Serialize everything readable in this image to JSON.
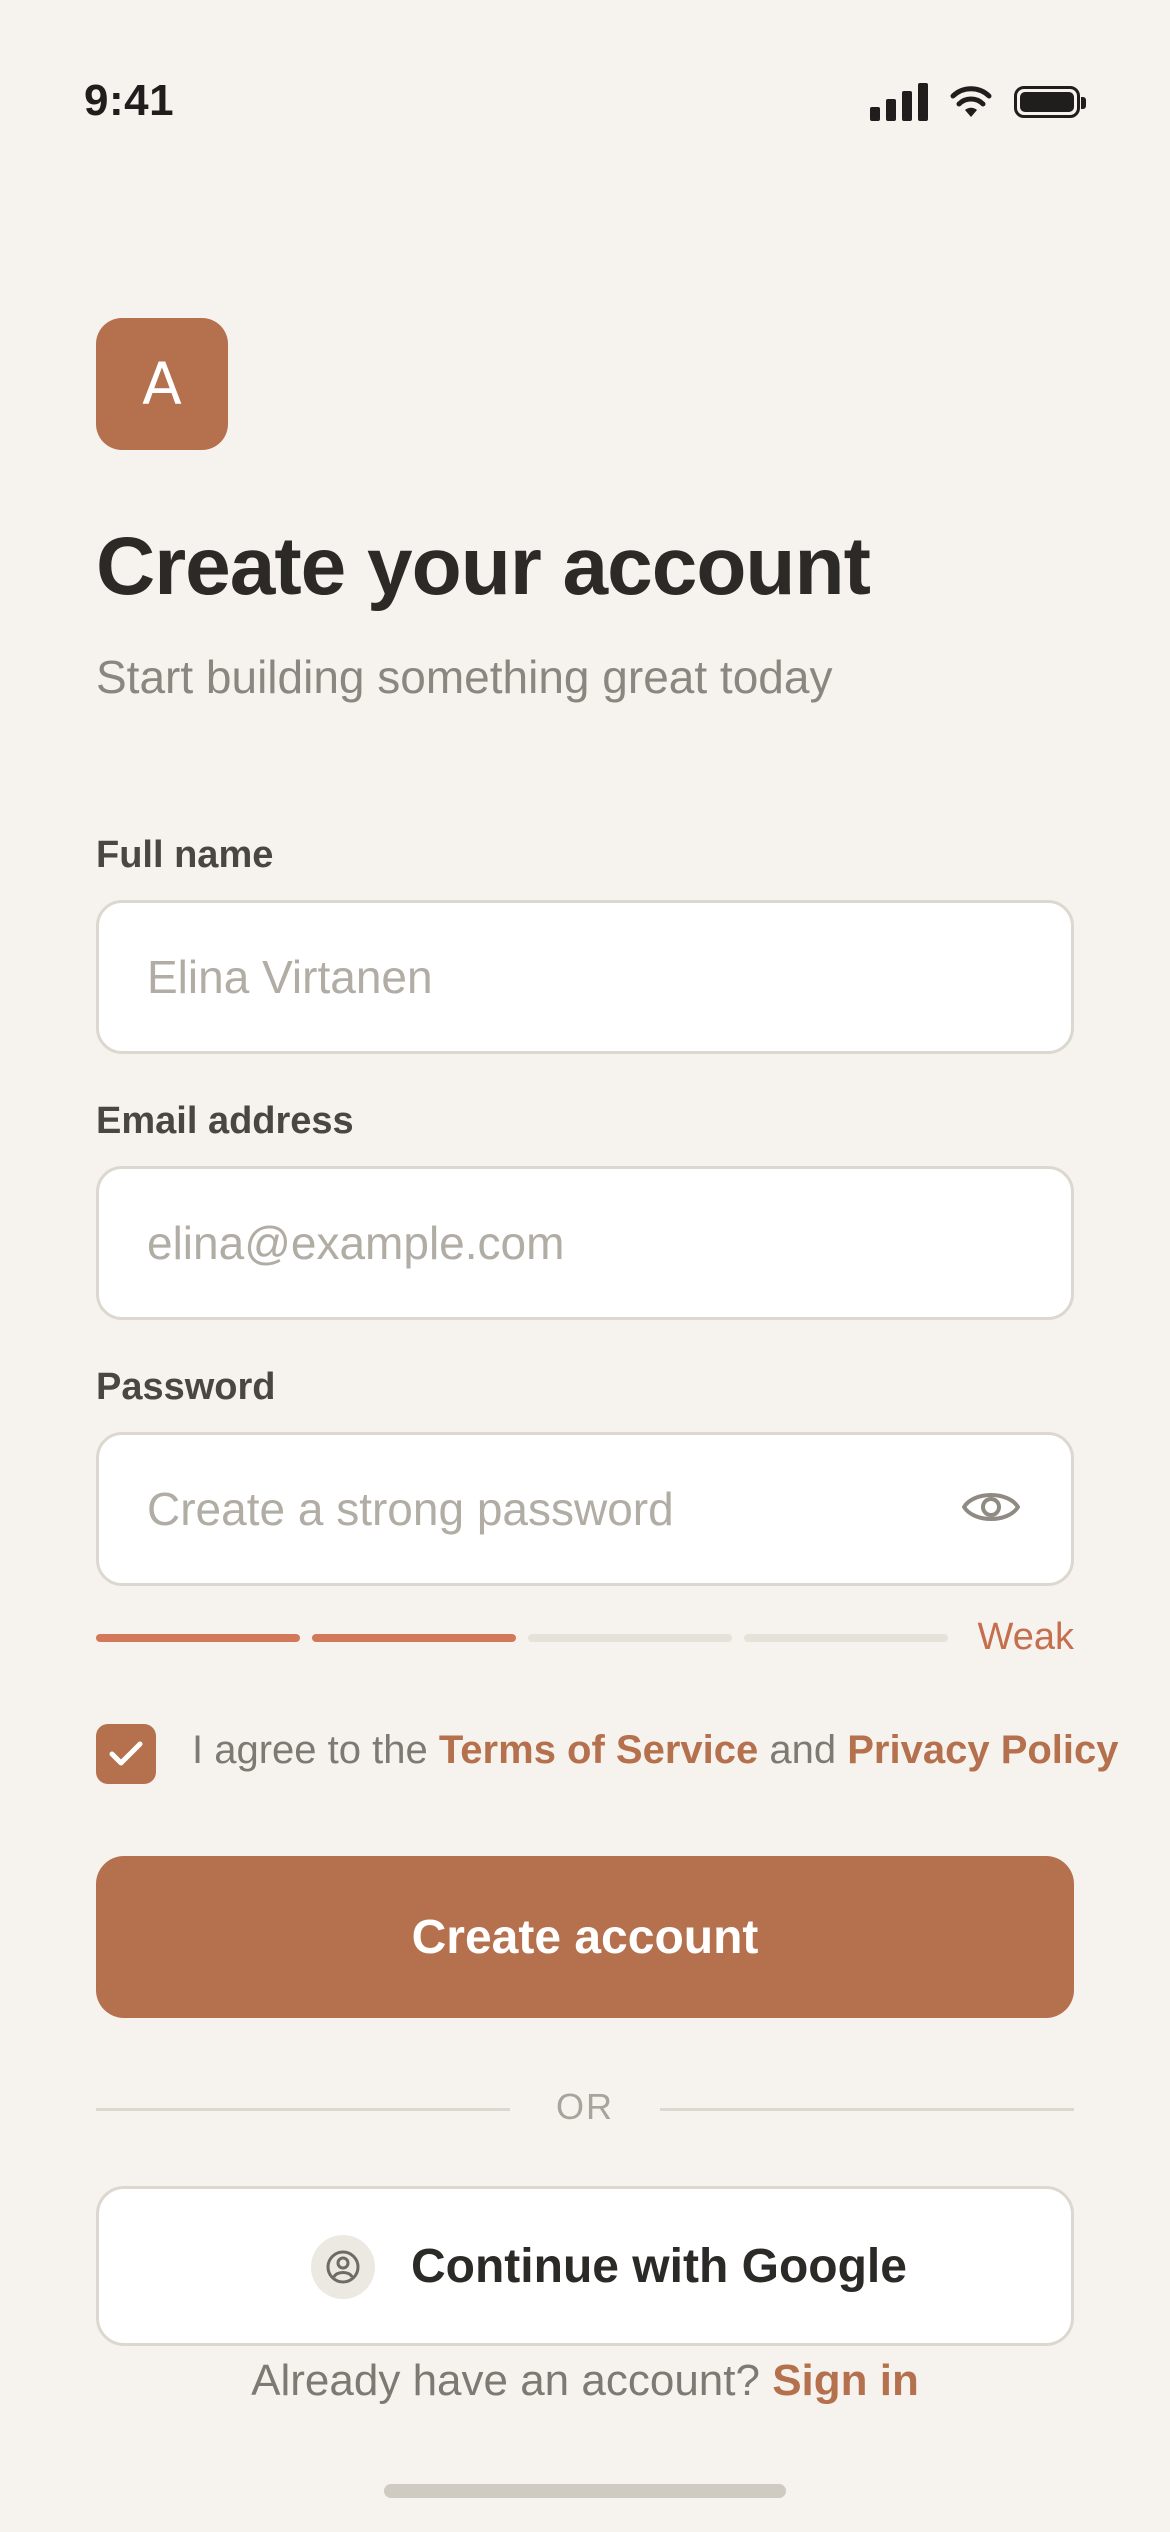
{
  "status_bar": {
    "time": "9:41"
  },
  "logo": {
    "letter": "A"
  },
  "header": {
    "title": "Create your account",
    "subtitle": "Start building something great today"
  },
  "form": {
    "full_name": {
      "label": "Full name",
      "placeholder": "Elina Virtanen",
      "value": ""
    },
    "email": {
      "label": "Email address",
      "placeholder": "elina@example.com",
      "value": ""
    },
    "password": {
      "label": "Password",
      "placeholder": "Create a strong password",
      "value": "",
      "visibility_icon": "eye-icon"
    },
    "strength": {
      "label": "Weak",
      "filled_segments": 2,
      "total_segments": 4
    },
    "agree": {
      "checked": true,
      "prefix": "I agree to the ",
      "terms": "Terms of Service",
      "middle": " and ",
      "privacy": "Privacy Policy"
    },
    "submit_label": "Create account"
  },
  "divider": {
    "label": "OR"
  },
  "social": {
    "google_label": "Continue with Google",
    "icon": "user-circle-icon"
  },
  "footer": {
    "prompt": "Already have an account? ",
    "link": "Sign in"
  },
  "colors": {
    "background": "#f6f3ee",
    "accent": "#b5704d",
    "strength_active": "#d3785a",
    "strength_inactive": "#e6e1d9"
  }
}
